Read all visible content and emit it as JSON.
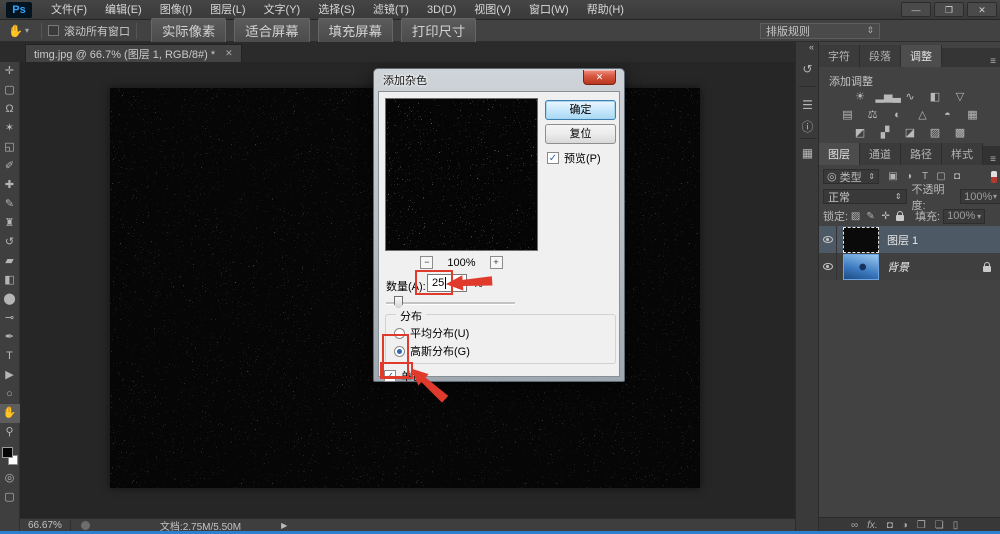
{
  "colors": {
    "annotation_red": "#e03a2d",
    "ps_logo_blue": "#31a8ff",
    "taskbar_blue": "#2d7fd0",
    "selected_layer_bg": "#4d5965"
  },
  "app": {
    "logo": "Ps",
    "menu": [
      "文件(F)",
      "编辑(E)",
      "图像(I)",
      "图层(L)",
      "文字(Y)",
      "选择(S)",
      "滤镜(T)",
      "3D(D)",
      "视图(V)",
      "窗口(W)",
      "帮助(H)"
    ],
    "window_controls": {
      "minimize": "—",
      "restore": "❐",
      "close": "✕"
    }
  },
  "options_bar": {
    "tool_icon": "✋",
    "caret": "▾",
    "scroll_all_windows_label": "滚动所有窗口",
    "buttons": [
      "实际像素",
      "适合屏幕",
      "填充屏幕",
      "打印尺寸"
    ],
    "arrange_dropdown": {
      "label": "排版规则",
      "caret": "⇕"
    }
  },
  "document": {
    "tab_title": "timg.jpg @ 66.7% (图层 1, RGB/8#) *",
    "tab_close": "✕",
    "status_zoom": "66.67%",
    "status_doc": "文档:2.75M/5.50M",
    "status_play": "▶"
  },
  "tools": [
    {
      "name": "move",
      "glyph": "✛"
    },
    {
      "name": "marquee",
      "glyph": "▢"
    },
    {
      "name": "lasso",
      "glyph": "Ω"
    },
    {
      "name": "magic-wand",
      "glyph": "✶"
    },
    {
      "name": "crop",
      "glyph": "◱"
    },
    {
      "name": "eyedropper",
      "glyph": "✐"
    },
    {
      "name": "healing-brush",
      "glyph": "✚"
    },
    {
      "name": "brush",
      "glyph": "✎"
    },
    {
      "name": "clone-stamp",
      "glyph": "♜"
    },
    {
      "name": "history-brush",
      "glyph": "↺"
    },
    {
      "name": "eraser",
      "glyph": "▰"
    },
    {
      "name": "gradient",
      "glyph": "◧"
    },
    {
      "name": "blur",
      "glyph": "⬤"
    },
    {
      "name": "dodge",
      "glyph": "⊸"
    },
    {
      "name": "pen",
      "glyph": "✒"
    },
    {
      "name": "type",
      "glyph": "T"
    },
    {
      "name": "path-select",
      "glyph": "▶"
    },
    {
      "name": "shape",
      "glyph": "○"
    },
    {
      "name": "hand",
      "glyph": "✋"
    },
    {
      "name": "zoom",
      "glyph": "⚲"
    }
  ],
  "dialog": {
    "title": "添加杂色",
    "close": "✕",
    "ok": "确定",
    "reset": "复位",
    "preview_label": "预览(P)",
    "zoom_out": "−",
    "zoom_value": "100%",
    "zoom_in": "+",
    "amount_label": "数量(A):",
    "amount_value": "25",
    "amount_unit": "%",
    "distribution_label": "分布",
    "uniform_label": "平均分布(U)",
    "gaussian_label": "高斯分布(G)",
    "monochromatic_label": "单色",
    "check": "✓"
  },
  "dock_icons": [
    {
      "name": "history",
      "glyph": "↺"
    },
    {
      "name": "properties",
      "glyph": "☰"
    },
    {
      "name": "info",
      "glyph": "ⓘ"
    },
    {
      "name": "styles",
      "glyph": "▦"
    }
  ],
  "panels": {
    "collapse_chevron": "«",
    "panel_menu": "≡",
    "top_tabs": [
      "字符",
      "段落",
      "调整"
    ],
    "adjustments": {
      "title": "添加调整",
      "row1": [
        {
          "name": "brightness-contrast",
          "glyph": "☀"
        },
        {
          "name": "levels",
          "glyph": "▂▅▃"
        },
        {
          "name": "curves",
          "glyph": "∿"
        },
        {
          "name": "exposure",
          "glyph": "◧"
        },
        {
          "name": "vibrance",
          "glyph": "▽"
        }
      ],
      "row2": [
        {
          "name": "hue-saturation",
          "glyph": "▤"
        },
        {
          "name": "color-balance",
          "glyph": "⚖"
        },
        {
          "name": "black-white",
          "glyph": "◐"
        },
        {
          "name": "photo-filter",
          "glyph": "△"
        },
        {
          "name": "channel-mixer",
          "glyph": "◓"
        },
        {
          "name": "color-lookup",
          "glyph": "▦"
        }
      ],
      "row3": [
        {
          "name": "invert",
          "glyph": "◩"
        },
        {
          "name": "posterize",
          "glyph": "▞"
        },
        {
          "name": "threshold",
          "glyph": "◪"
        },
        {
          "name": "gradient-map",
          "glyph": "▨"
        },
        {
          "name": "selective-color",
          "glyph": "▩"
        }
      ]
    },
    "layers": {
      "tabs": [
        "图层",
        "通道",
        "路径",
        "样式"
      ],
      "search_icon": "◎",
      "filter_type_label": "类型",
      "caret": "⇕",
      "filter_icons": [
        {
          "name": "filter-pixel-layers",
          "glyph": "▣"
        },
        {
          "name": "filter-adjustment-layers",
          "glyph": "◑"
        },
        {
          "name": "filter-type-layers",
          "glyph": "T"
        },
        {
          "name": "filter-shape-layers",
          "glyph": "▢"
        },
        {
          "name": "filter-smart-objects",
          "glyph": "◘"
        }
      ],
      "blend_mode": "正常",
      "opacity_label": "不透明度:",
      "opacity_value": "100%",
      "lock_label": "锁定:",
      "lock_icons": [
        {
          "name": "lock-transparent",
          "glyph": "▨"
        },
        {
          "name": "lock-pixels",
          "glyph": "✎"
        },
        {
          "name": "lock-position",
          "glyph": "✛"
        }
      ],
      "fill_label": "填充:",
      "fill_value": "100%",
      "rows": [
        {
          "name": "图层 1"
        },
        {
          "name": "背景"
        }
      ],
      "bottom_icons": [
        {
          "name": "link-layers",
          "glyph": "∞"
        },
        {
          "name": "layer-style",
          "glyph": "fx."
        },
        {
          "name": "layer-mask",
          "glyph": "◘"
        },
        {
          "name": "new-adjustment",
          "glyph": "◑"
        },
        {
          "name": "new-group",
          "glyph": "❐"
        },
        {
          "name": "new-layer",
          "glyph": "❏"
        },
        {
          "name": "delete-layer",
          "glyph": "▯"
        }
      ]
    }
  }
}
